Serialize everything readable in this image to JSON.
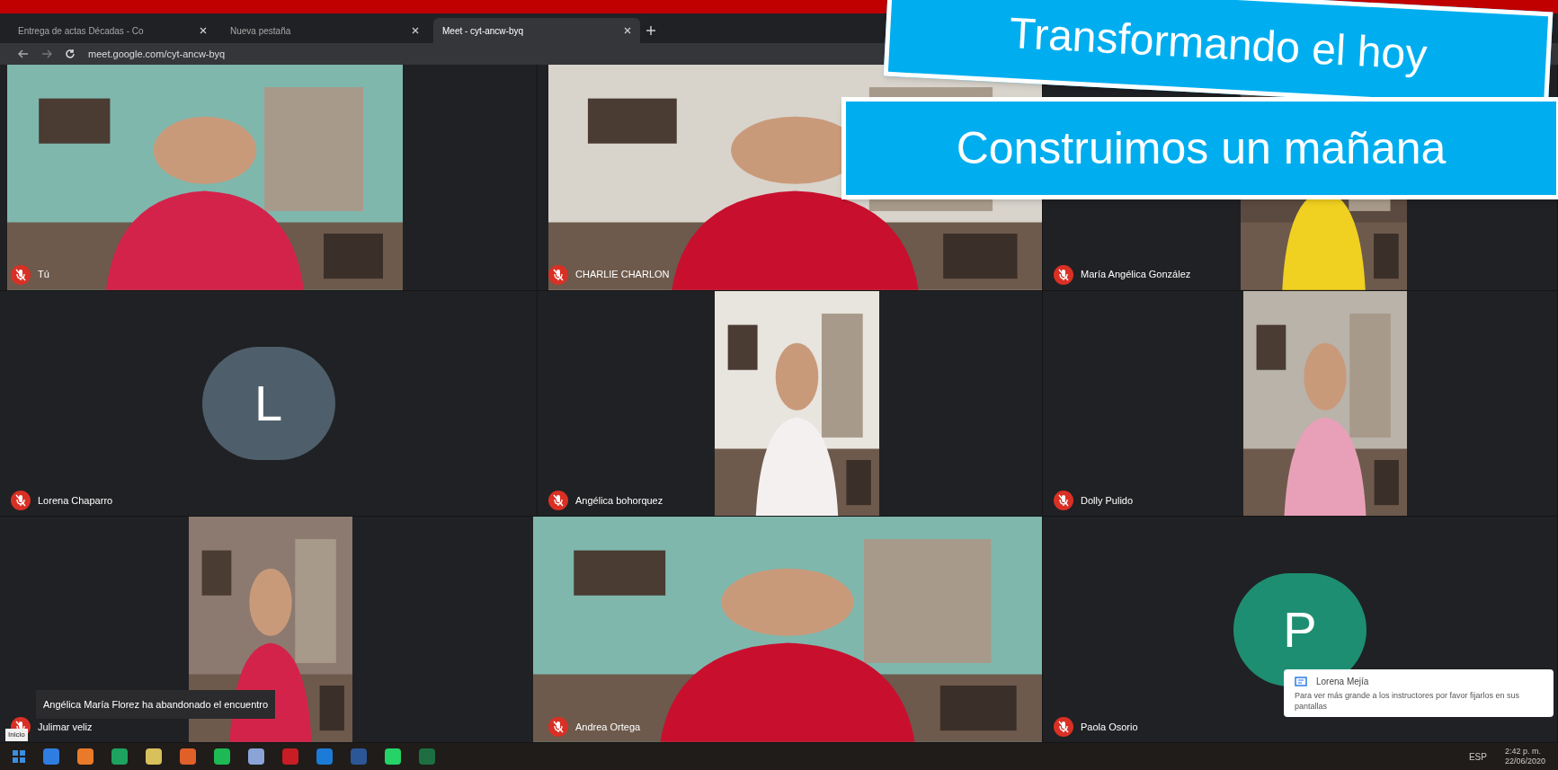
{
  "browser": {
    "tabs": [
      {
        "title": "Entrega de actas Décadas - Co",
        "selected": false
      },
      {
        "title": "Nueva pestaña",
        "selected": false
      },
      {
        "title": "Meet - cyt-ancw-byq",
        "selected": true
      }
    ],
    "url": "meet.google.com/cyt-ancw-byq"
  },
  "grid": [
    [
      {
        "kind": "video",
        "name": "Tú"
      },
      {
        "kind": "video",
        "name": "CHARLIE CHARLON"
      },
      {
        "kind": "video",
        "name": "María Angélica González"
      }
    ],
    [
      {
        "kind": "avatar",
        "letter": "L",
        "color": "#4e5f6b",
        "name": "Lorena Chaparro"
      },
      {
        "kind": "video",
        "name": "Angélica bohorquez"
      },
      {
        "kind": "video",
        "name": "Dolly Pulido"
      }
    ],
    [
      {
        "kind": "video",
        "name": "Julimar veliz",
        "notice": "Angélica María Florez ha abandonado el encuentro"
      },
      {
        "kind": "video",
        "name": "Andrea Ortega"
      },
      {
        "kind": "avatar",
        "letter": "P",
        "color": "#1e8e72",
        "name": "Paola Osorio"
      }
    ]
  ],
  "chat_toast": {
    "sender": "Lorena Mejía",
    "message": "Para ver más grande a los instructores por favor fijarlos en sus pantallas"
  },
  "banner": {
    "line_1": "Transformando el hoy",
    "line_2": "Construimos un mañana"
  },
  "taskbar": {
    "tooltip": "Inicio",
    "language": "ESP",
    "time": "2:42 p. m.",
    "date": "22/06/2020"
  }
}
